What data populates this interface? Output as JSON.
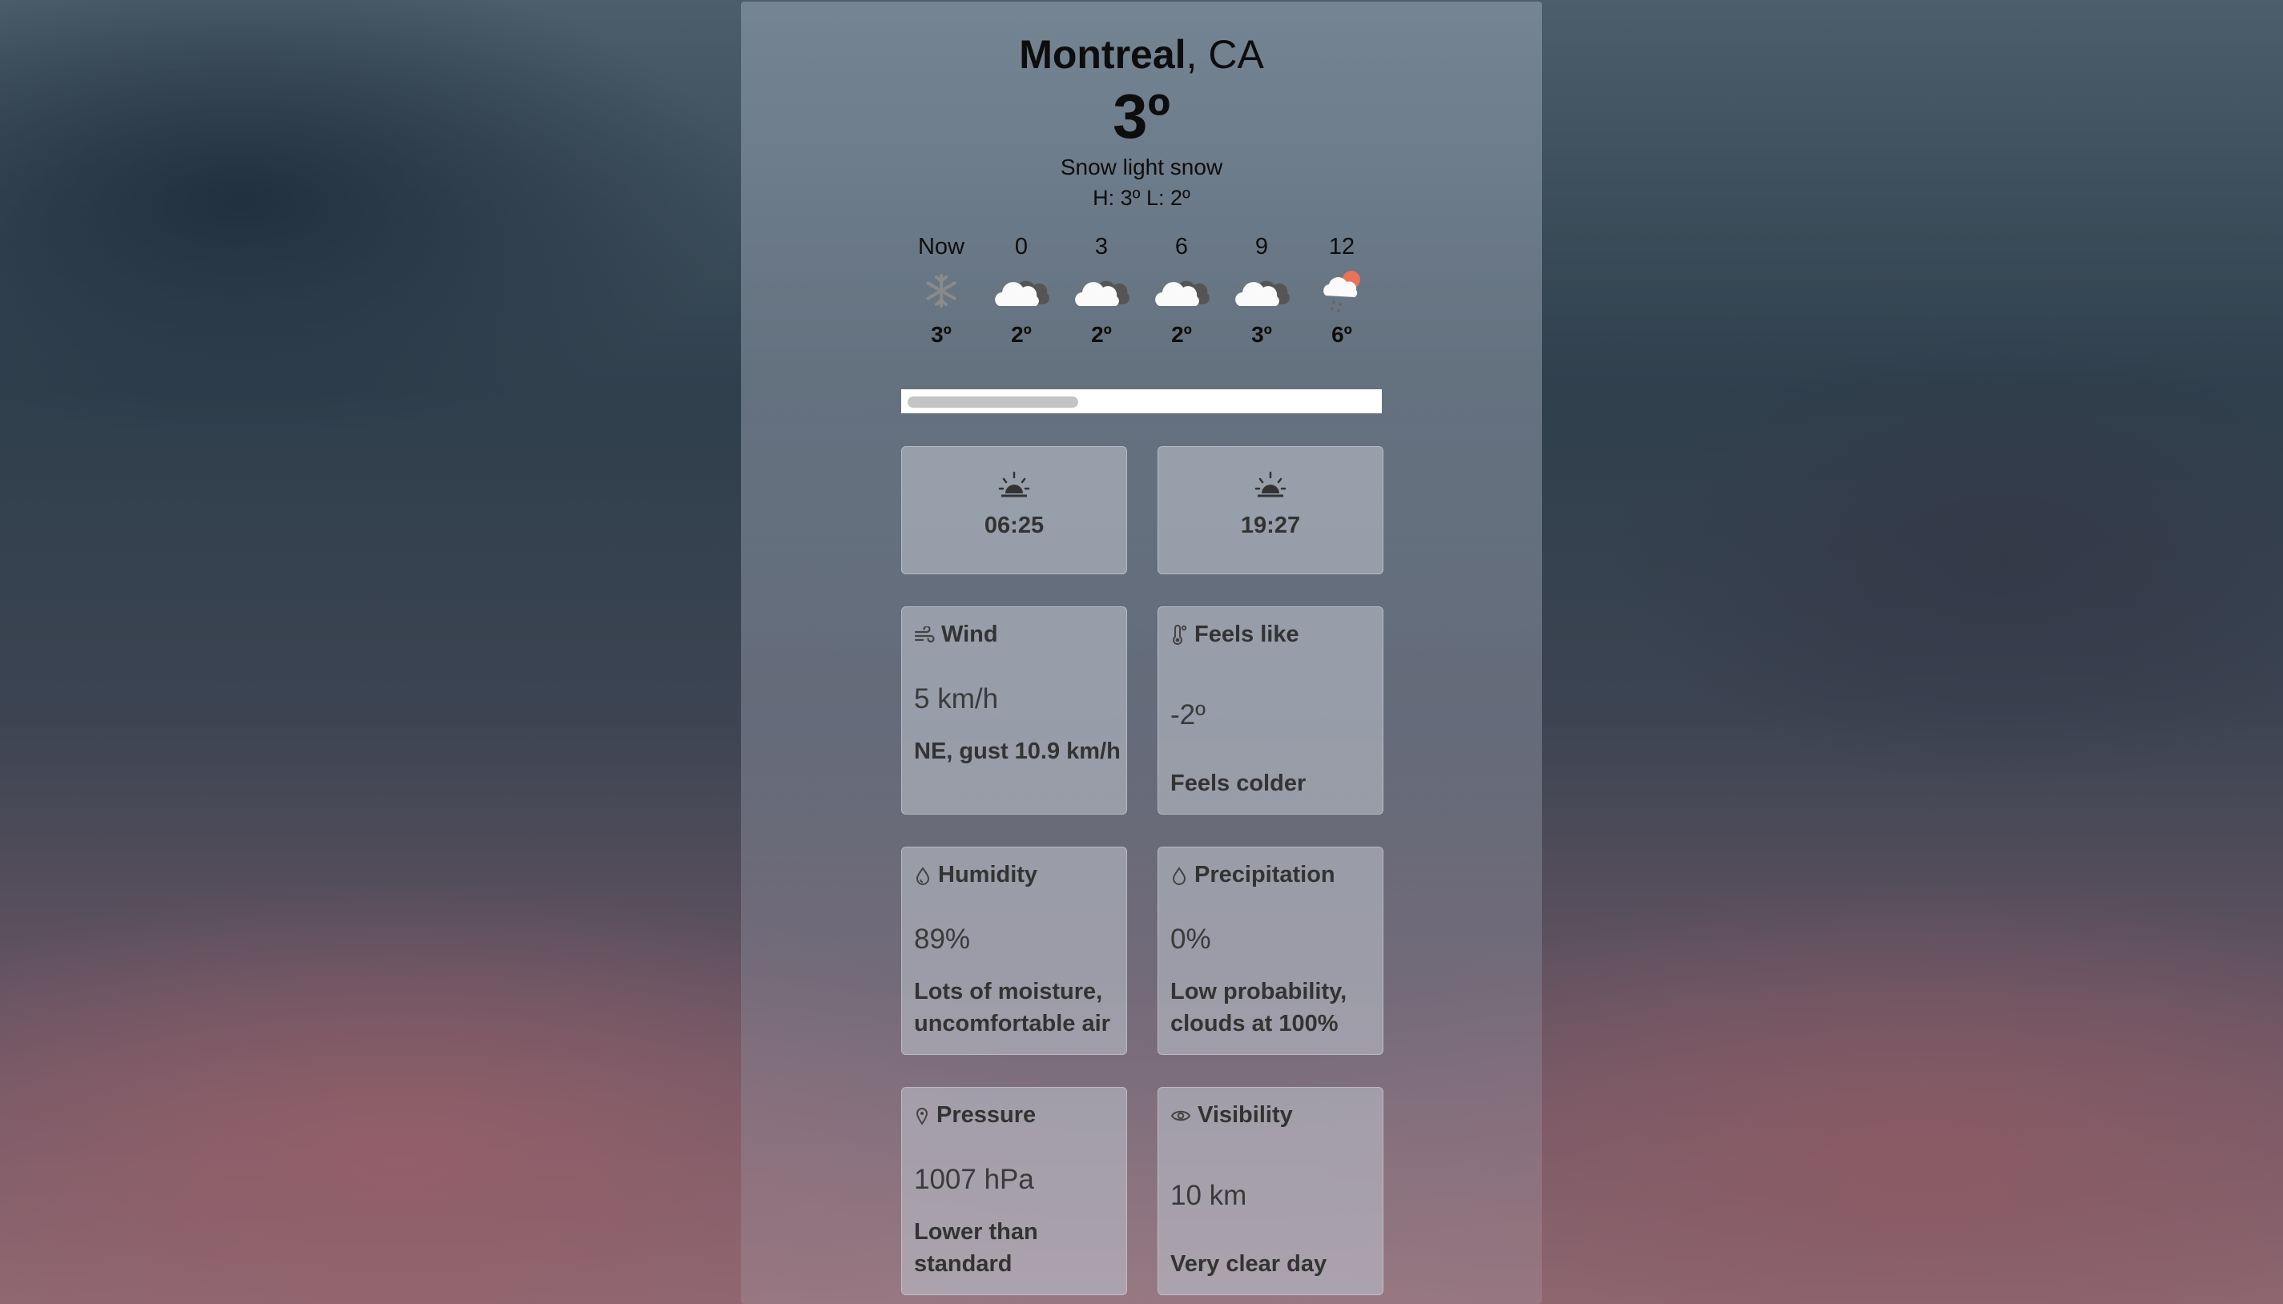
{
  "location": {
    "city": "Montreal",
    "country": ", CA"
  },
  "current": {
    "temp": "3º",
    "description": "Snow light snow",
    "high_low": "H: 3º L: 2º"
  },
  "hourly": [
    {
      "label": "Now",
      "icon": "snowflake-icon",
      "temp": "3º"
    },
    {
      "label": "0",
      "icon": "cloud-icon",
      "temp": "2º"
    },
    {
      "label": "3",
      "icon": "cloud-icon",
      "temp": "2º"
    },
    {
      "label": "6",
      "icon": "cloud-icon",
      "temp": "2º"
    },
    {
      "label": "9",
      "icon": "cloud-icon",
      "temp": "3º"
    },
    {
      "label": "12",
      "icon": "sun-cloud-snow-icon",
      "temp": "6º"
    }
  ],
  "sun": {
    "sunrise": "06:25",
    "sunset": "19:27"
  },
  "details": {
    "wind": {
      "title": "Wind",
      "value": "5 km/h",
      "note": "NE, gust 10.9 km/h"
    },
    "feels_like": {
      "title": "Feels like",
      "value": "-2º",
      "note": "Feels colder"
    },
    "humidity": {
      "title": "Humidity",
      "value": "89%",
      "note": "Lots of moisture, uncomfortable air"
    },
    "precipitation": {
      "title": "Precipitation",
      "value": "0%",
      "note": "Low probability, clouds at 100%"
    },
    "pressure": {
      "title": "Pressure",
      "value": "1007 hPa",
      "note": "Lower than standard"
    },
    "visibility": {
      "title": "Visibility",
      "value": "10 km",
      "note": "Very clear day"
    }
  },
  "colors": {
    "accent_sun": "#e8735a",
    "card_bg": "#b9bec8",
    "text": "#0d0d0d"
  }
}
